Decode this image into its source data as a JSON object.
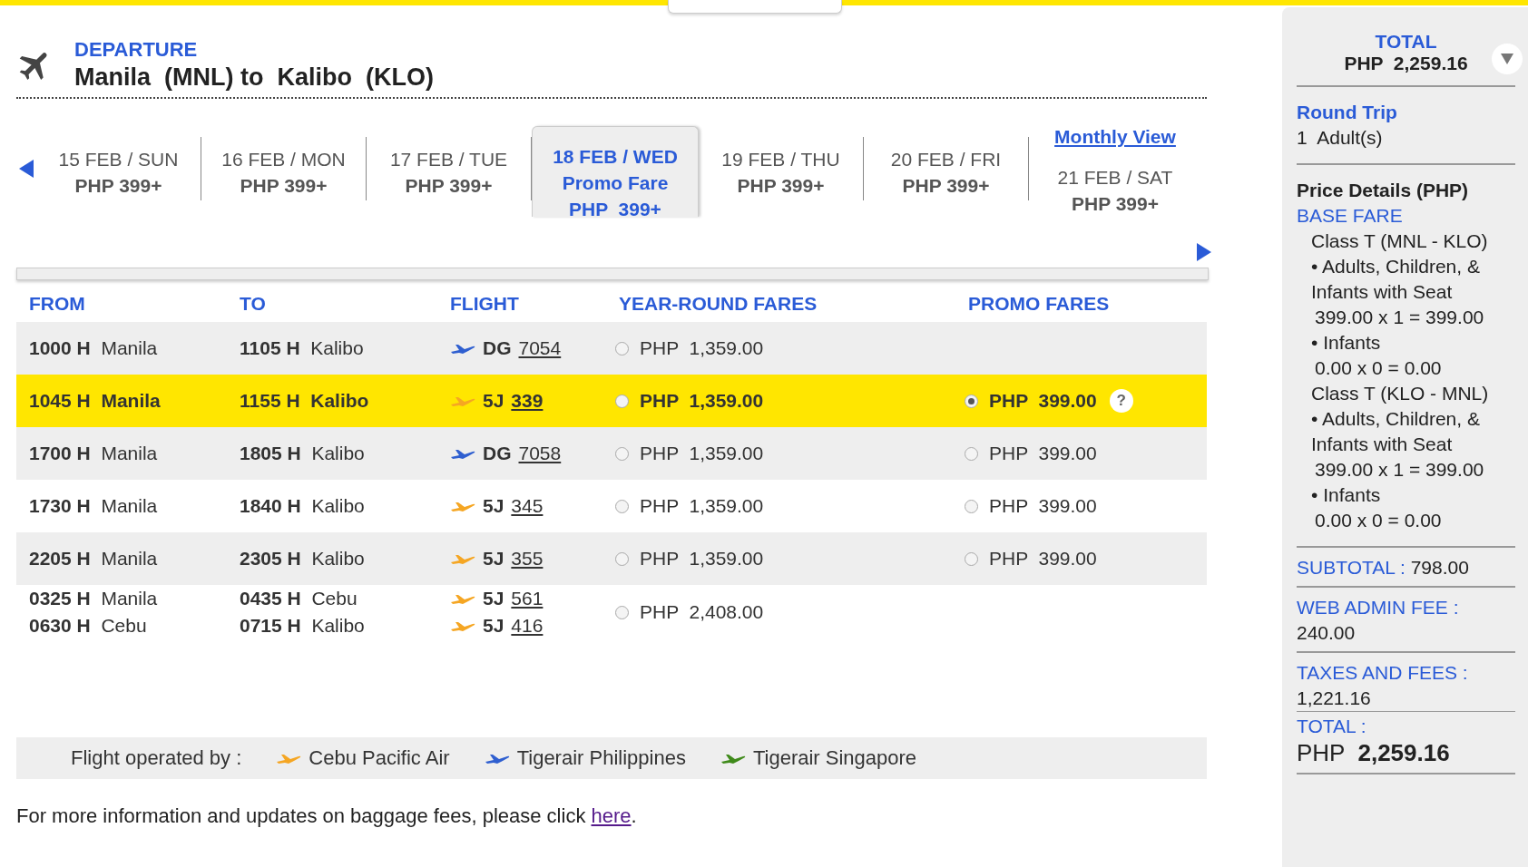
{
  "header": {
    "label": "DEPARTURE",
    "route": "Manila  (MNL) to  Kalibo  (KLO)"
  },
  "dates": [
    {
      "date": "15 FEB / SUN",
      "price": "PHP 399+",
      "selected": false
    },
    {
      "date": "16 FEB / MON",
      "price": "PHP 399+",
      "selected": false
    },
    {
      "date": "17 FEB / TUE",
      "price": "PHP 399+",
      "selected": false
    },
    {
      "date": "18 FEB / WED",
      "note": "Promo Fare",
      "price": "PHP  399+",
      "selected": true
    },
    {
      "date": "19 FEB / THU",
      "price": "PHP 399+",
      "selected": false
    },
    {
      "date": "20 FEB / FRI",
      "price": "PHP 399+",
      "selected": false
    },
    {
      "date": "21 FEB / SAT",
      "price": "PHP 399+",
      "selected": false
    }
  ],
  "monthly_view": "Monthly View",
  "table": {
    "columns": [
      "FROM",
      "TO",
      "FLIGHT",
      "YEAR-ROUND FARES",
      "PROMO FARES"
    ],
    "rows": [
      {
        "selected": false,
        "legs": [
          {
            "dep_time": "1000 H",
            "dep_city": "Manila",
            "arr_time": "1105 H",
            "arr_city": "Kalibo",
            "color": "#2f5fd0",
            "carrier": "DG",
            "number": "7054"
          }
        ],
        "year_round": {
          "price": "PHP  1,359.00",
          "selected": false
        }
      },
      {
        "selected": true,
        "legs": [
          {
            "dep_time": "1045 H",
            "dep_city": "Manila",
            "arr_time": "1155 H",
            "arr_city": "Kalibo",
            "color": "#f5a623",
            "carrier": "5J",
            "number": "339"
          }
        ],
        "year_round": {
          "price": "PHP  1,359.00",
          "selected": false
        },
        "promo": {
          "price": "PHP  399.00",
          "selected": true,
          "help": "?"
        }
      },
      {
        "selected": false,
        "legs": [
          {
            "dep_time": "1700 H",
            "dep_city": "Manila",
            "arr_time": "1805 H",
            "arr_city": "Kalibo",
            "color": "#2f5fd0",
            "carrier": "DG",
            "number": "7058"
          }
        ],
        "year_round": {
          "price": "PHP  1,359.00",
          "selected": false
        },
        "promo": {
          "price": "PHP  399.00",
          "selected": false
        }
      },
      {
        "selected": false,
        "legs": [
          {
            "dep_time": "1730 H",
            "dep_city": "Manila",
            "arr_time": "1840 H",
            "arr_city": "Kalibo",
            "color": "#f5a623",
            "carrier": "5J",
            "number": "345"
          }
        ],
        "year_round": {
          "price": "PHP  1,359.00",
          "selected": false
        },
        "promo": {
          "price": "PHP  399.00",
          "selected": false
        }
      },
      {
        "selected": false,
        "legs": [
          {
            "dep_time": "2205 H",
            "dep_city": "Manila",
            "arr_time": "2305 H",
            "arr_city": "Kalibo",
            "color": "#f5a623",
            "carrier": "5J",
            "number": "355"
          }
        ],
        "year_round": {
          "price": "PHP  1,359.00",
          "selected": false
        },
        "promo": {
          "price": "PHP  399.00",
          "selected": false
        }
      },
      {
        "selected": false,
        "legs": [
          {
            "dep_time": "0325 H",
            "dep_city": "Manila",
            "arr_time": "0435 H",
            "arr_city": "Cebu",
            "color": "#f5a623",
            "carrier": "5J",
            "number": "561"
          },
          {
            "dep_time": "0630 H",
            "dep_city": "Cebu",
            "arr_time": "0715 H",
            "arr_city": "Kalibo",
            "color": "#f5a623",
            "carrier": "5J",
            "number": "416"
          }
        ],
        "year_round": {
          "price": "PHP  2,408.00",
          "selected": false
        }
      }
    ]
  },
  "legend": {
    "label": "Flight operated by :",
    "airlines": [
      {
        "name": "Cebu Pacific Air",
        "color": "#f5a623"
      },
      {
        "name": "Tigerair Philippines",
        "color": "#2f5fd0"
      },
      {
        "name": "Tigerair Singapore",
        "color": "#3f8a1a"
      }
    ]
  },
  "baggage_note": {
    "text": "For more information and updates on baggage fees, please click ",
    "link": "here",
    "end": "."
  },
  "sidebar": {
    "total_label": "TOTAL",
    "total": "PHP  2,259.16",
    "trip_type": "Round Trip",
    "passengers": "1  Adult(s)",
    "details_title": "Price Details (PHP)",
    "base_fare_label": "BASE FARE",
    "lines": [
      {
        "kind": "class",
        "text": "Class T (MNL - KLO)"
      },
      {
        "kind": "bullet",
        "text": "• Adults, Children, & Infants with Seat"
      },
      {
        "kind": "calc",
        "text": "399.00 x 1 = 399.00"
      },
      {
        "kind": "bullet",
        "text": "• Infants"
      },
      {
        "kind": "calc",
        "text": "0.00 x 0 = 0.00"
      },
      {
        "kind": "class",
        "text": "Class T (KLO - MNL)"
      },
      {
        "kind": "bullet",
        "text": "• Adults, Children, & Infants with Seat"
      },
      {
        "kind": "calc",
        "text": "399.00 x 1 = 399.00"
      },
      {
        "kind": "bullet",
        "text": "• Infants"
      },
      {
        "kind": "calc",
        "text": "0.00 x 0 = 0.00"
      }
    ],
    "subtotal_label": "SUBTOTAL :",
    "subtotal": "798.00",
    "admin_label": "WEB ADMIN FEE :",
    "admin": "240.00",
    "taxes_label": "TAXES AND FEES :",
    "taxes": "1,221.16",
    "grand_label": "TOTAL :",
    "grand_currency": "PHP",
    "grand_amount": "2,259.16"
  }
}
